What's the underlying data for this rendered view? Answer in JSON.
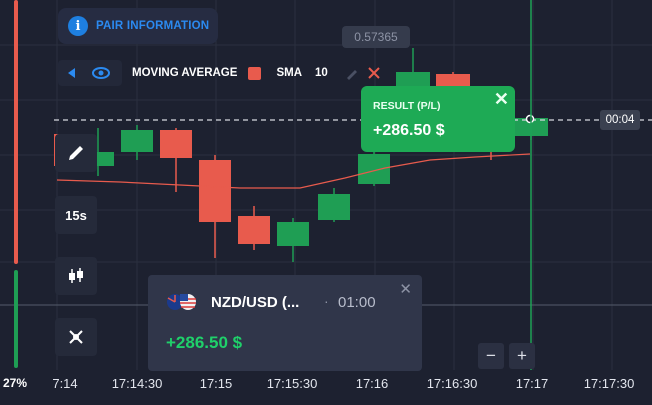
{
  "sentiment": {
    "percent": "27%",
    "up_fraction": 0.27
  },
  "pair_info": {
    "icon": "info-icon",
    "label": "PAIR INFORMATION"
  },
  "indicator": {
    "name": "MOVING AVERAGE",
    "color": "#e85b4d",
    "type": "SMA",
    "period": "10",
    "icons": [
      "arrow-left-icon",
      "eye-icon",
      "pencil-icon",
      "close-icon"
    ]
  },
  "price_label": "0.57365",
  "countdown": "00:04",
  "tools": {
    "timeframe": "15s",
    "icons": [
      "pencil-icon",
      "candlestick-icon",
      "drawing-tools-icon"
    ]
  },
  "result_popup": {
    "label": "RESULT (P/L)",
    "value": "+286.50 $",
    "close_icon": "close-icon"
  },
  "trade_card": {
    "pair": "NZD/USD (...",
    "duration": "01:00",
    "profit": "+286.50 $",
    "flags": [
      "nz-flag",
      "us-flag"
    ],
    "close_icon": "close-icon"
  },
  "zoom": {
    "minus": "−",
    "plus": "+"
  },
  "time_axis": [
    "7:14",
    "17:14:30",
    "17:15",
    "17:15:30",
    "17:16",
    "17:16:30",
    "17:17",
    "17:17:30"
  ],
  "colors": {
    "up": "#1f9e54",
    "down": "#e85b4d",
    "background": "#1d2130",
    "accent": "#2b8af0",
    "result_green": "#1eaa55"
  },
  "chart_data": {
    "type": "candlestick",
    "candles": [
      {
        "dir": "down"
      },
      {
        "dir": "up"
      },
      {
        "dir": "up"
      },
      {
        "dir": "down"
      },
      {
        "dir": "down"
      },
      {
        "dir": "down"
      },
      {
        "dir": "up"
      },
      {
        "dir": "up"
      },
      {
        "dir": "up"
      },
      {
        "dir": "up"
      },
      {
        "dir": "down"
      },
      {
        "dir": "down"
      },
      {
        "dir": "up"
      }
    ],
    "overlay": "SMA 10"
  }
}
